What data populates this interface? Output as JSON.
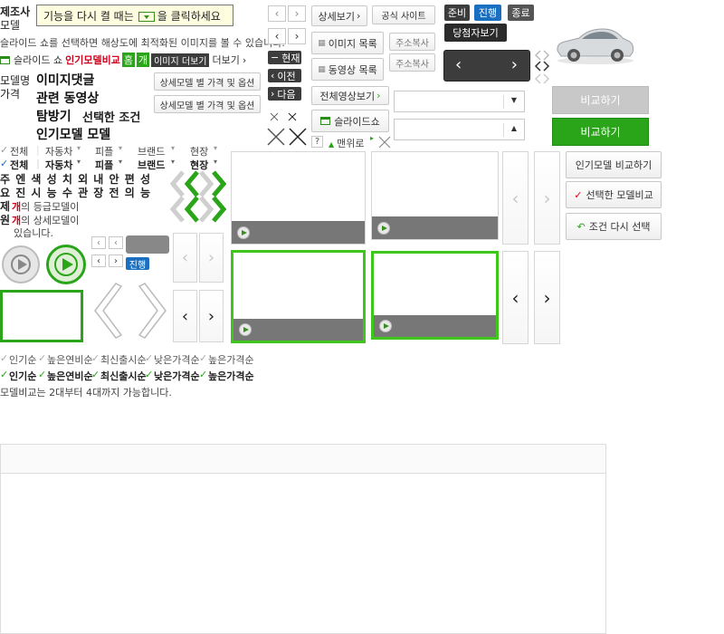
{
  "top_left": {
    "maker": "제조사",
    "model": "모델",
    "notice_prefix": "기능을 다시 켤 때는",
    "notice_suffix": "을 클릭하세요",
    "slide_desc": "슬라이드 쇼를 선택하면 해상도에 최적화된 이미지를 볼 수 있습니다.",
    "slideshow_label": "슬라이드 쇼",
    "popular_compare": "인기모델비교",
    "tag_home": "홈",
    "tag_ga": "개",
    "more_images": "이미지 더보기",
    "more": "더보기"
  },
  "model_block": {
    "model_name_1": "모델명",
    "price": "가격",
    "image_comment": "이미지댓글",
    "related_video": "관련 동영상",
    "explore": "탐방기",
    "selected_condition": "선택한 조건",
    "popular_model": "인기모델 모델",
    "detail_price_options_1": "상세모델 별 가격 및 옵션",
    "detail_price_options_2": "상세모델 별 가격 및 옵션"
  },
  "filters": {
    "row1": [
      "전체",
      "자동차",
      "피플",
      "브랜드",
      "현장"
    ],
    "row2": [
      "전체",
      "자동차",
      "피플",
      "브랜드",
      "현장"
    ]
  },
  "spec_rows": {
    "row1": "주 엔 색 성 치  외 내 안 편 성",
    "row2": "요 진 시 능 수  관 장 전 의 능",
    "grade_prefix": "제",
    "grade_red": "개",
    "grade_suffix": "의 등급모델이",
    "sub_prefix": "원",
    "sub_red": "개",
    "sub_suffix": "의 상세모델이",
    "exists": "있습니다."
  },
  "nav_small": {
    "current": "현재",
    "prev": "이전",
    "next": "다음"
  },
  "mid_buttons": {
    "detail_view": "상세보기",
    "official_site": "공식 사이트",
    "image_list": "이미지 목록",
    "video_list": "동영상 목록",
    "copy_address_1": "주소복사",
    "copy_address_2": "주소복사",
    "all_video_view": "전체영상보기",
    "slideshow": "슬라이드쇼",
    "help": "?",
    "top": "맨위로"
  },
  "status": {
    "ready": "준비",
    "progress": "진행",
    "end": "종료",
    "winner": "당첨자보기",
    "progress_small": "진행"
  },
  "right_panel": {
    "compare_disabled": "비교하기",
    "compare": "비교하기",
    "popular_compare": "인기모델 비교하기",
    "selected_compare": "선택한 모델비교",
    "reselect": "조건 다시 선택"
  },
  "sort": {
    "inactive": [
      "인기순",
      "높은연비순",
      "최신출시순",
      "낮은가격순",
      "높은가격순"
    ],
    "active": [
      "인기순",
      "높은연비순",
      "최신출시순",
      "낮은가격순",
      "높은가격순"
    ],
    "compare_note": "모델비교는 2대부터 4대까지 가능합니다."
  },
  "colors": {
    "green": "#2aa51a",
    "bright_green": "#3ec61a",
    "dark": "#3c3c3c",
    "blue": "#1a6fc0",
    "red": "#d0021b"
  },
  "icons": [
    "play-icon",
    "chevron-left-icon",
    "chevron-right-icon",
    "close-icon",
    "check-icon",
    "grid-icon",
    "window-icon",
    "refresh-icon",
    "car-image"
  ]
}
